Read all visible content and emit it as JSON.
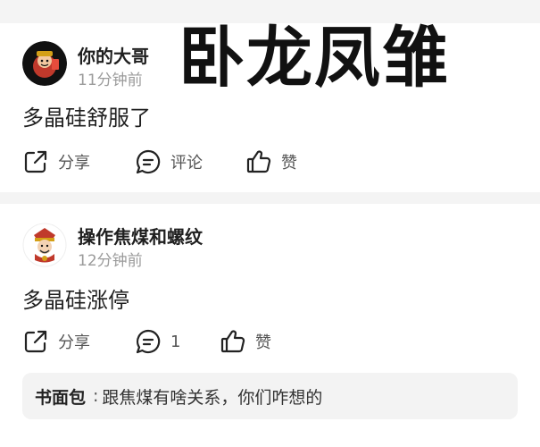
{
  "overlay": {
    "title": "卧龙凤雏"
  },
  "comments": [
    {
      "username": "你的大哥",
      "timestamp": "11分钟前",
      "content": "多晶硅舒服了",
      "actions": {
        "share": "分享",
        "comment": "评论",
        "like": "赞"
      }
    },
    {
      "username": "操作焦煤和螺纹",
      "timestamp": "12分钟前",
      "content": "多晶硅涨停",
      "actions": {
        "share": "分享",
        "comment": "1",
        "like": "赞"
      },
      "reply": {
        "author": "书面包",
        "separator": ":",
        "text": "跟焦煤有啥关系，你们咋想的"
      }
    }
  ],
  "colors": {
    "background": "#f4f4f4",
    "card": "#ffffff",
    "muted": "#9b9b9b",
    "reply_bg": "#f3f3f3"
  },
  "icons": [
    "share-icon",
    "comment-icon",
    "like-icon"
  ]
}
